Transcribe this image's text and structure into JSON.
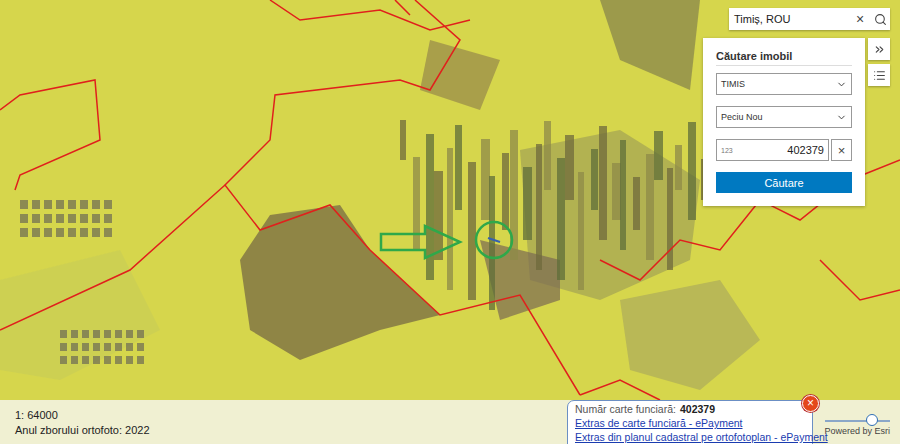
{
  "search": {
    "value": "Timiș, ROU",
    "clear": "×"
  },
  "panel": {
    "title": "Căutare imobil",
    "county": "TIMIS",
    "locality": "Peciu Nou",
    "field_prefix": "123",
    "field_value": "402379",
    "clear": "×",
    "button": "Căutare"
  },
  "map": {
    "scale": "1: 64000",
    "ortho_year": "Anul zborului ortofoto: 2022"
  },
  "popup": {
    "label": "Număr carte funciară:",
    "value": "402379",
    "links": [
      "Extras de carte funciară - ePayment",
      "Extras din planul cadastral pe ortofotoplan - ePayment"
    ],
    "close": "×"
  },
  "zoom": {
    "level": 0.72
  },
  "attribution": "Powered by Esri"
}
